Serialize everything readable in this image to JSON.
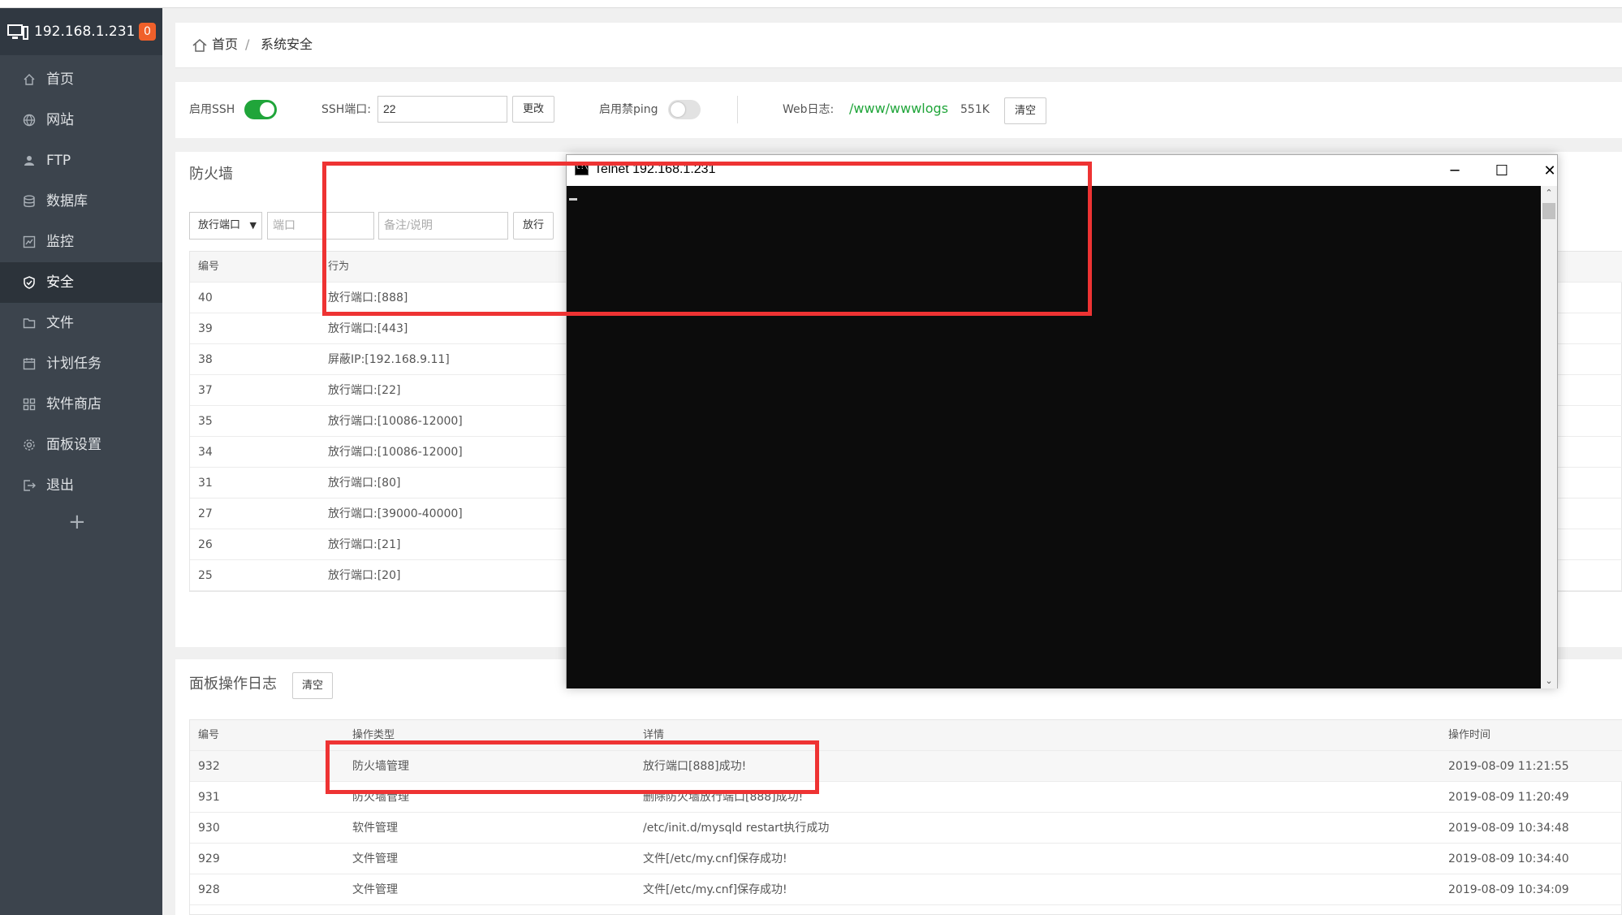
{
  "sidebar": {
    "host": "192.168.1.231",
    "badge": "0",
    "items": [
      {
        "label": "首页",
        "icon": "home-icon"
      },
      {
        "label": "网站",
        "icon": "globe-icon"
      },
      {
        "label": "FTP",
        "icon": "ftp-icon"
      },
      {
        "label": "数据库",
        "icon": "database-icon"
      },
      {
        "label": "监控",
        "icon": "monitor-icon"
      },
      {
        "label": "安全",
        "icon": "shield-icon",
        "active": true
      },
      {
        "label": "文件",
        "icon": "folder-icon"
      },
      {
        "label": "计划任务",
        "icon": "calendar-icon"
      },
      {
        "label": "软件商店",
        "icon": "apps-icon"
      },
      {
        "label": "面板设置",
        "icon": "gear-icon"
      },
      {
        "label": "退出",
        "icon": "logout-icon"
      }
    ],
    "add": "+"
  },
  "breadcrumb": {
    "home": "首页",
    "separator": "/",
    "current": "系统安全"
  },
  "ssh": {
    "enable_label": "启用SSH",
    "port_label": "SSH端口:",
    "port_value": "22",
    "change_button": "更改",
    "ping_label": "启用禁ping",
    "weblog_label": "Web日志:",
    "weblog_path": "/www/wwwlogs",
    "weblog_size": "551K",
    "clear_button": "清空"
  },
  "firewall": {
    "title": "防火墙",
    "select_value": "放行端口",
    "port_placeholder": "端口",
    "note_placeholder": "备注/说明",
    "allow_button": "放行",
    "columns": [
      "编号",
      "行为"
    ],
    "rows": [
      {
        "id": "40",
        "action": "放行端口:[888]"
      },
      {
        "id": "39",
        "action": "放行端口:[443]"
      },
      {
        "id": "38",
        "action": "屏蔽IP:[192.168.9.11]"
      },
      {
        "id": "37",
        "action": "放行端口:[22]"
      },
      {
        "id": "35",
        "action": "放行端口:[10086-12000]"
      },
      {
        "id": "34",
        "action": "放行端口:[10086-12000]"
      },
      {
        "id": "31",
        "action": "放行端口:[80]"
      },
      {
        "id": "27",
        "action": "放行端口:[39000-40000]"
      },
      {
        "id": "26",
        "action": "放行端口:[21]"
      },
      {
        "id": "25",
        "action": "放行端口:[20]"
      }
    ]
  },
  "panel_log": {
    "title": "面板操作日志",
    "clear_button": "清空",
    "columns": [
      "编号",
      "操作类型",
      "详情",
      "操作时间"
    ],
    "rows": [
      {
        "id": "932",
        "type": "防火墙管理",
        "detail": "放行端口[888]成功!",
        "time": "2019-08-09 11:21:55"
      },
      {
        "id": "931",
        "type": "防火墙管理",
        "detail": "删除防火墙放行端口[888]成功!",
        "time": "2019-08-09 11:20:49"
      },
      {
        "id": "930",
        "type": "软件管理",
        "detail": "/etc/init.d/mysqld restart执行成功",
        "time": "2019-08-09 10:34:48"
      },
      {
        "id": "929",
        "type": "文件管理",
        "detail": "文件[/etc/my.cnf]保存成功!",
        "time": "2019-08-09 10:34:40"
      },
      {
        "id": "928",
        "type": "文件管理",
        "detail": "文件[/etc/my.cnf]保存成功!",
        "time": "2019-08-09 10:34:09"
      }
    ]
  },
  "telnet": {
    "title": "Telnet 192.168.1.231",
    "icon_text": "C:\\",
    "minimize": "─",
    "maximize": "☐",
    "close": "✕"
  },
  "colors": {
    "accent": "#20a53a",
    "badge": "#f0602a",
    "sidebar": "#3c444d",
    "highlight": "#ee3333"
  }
}
